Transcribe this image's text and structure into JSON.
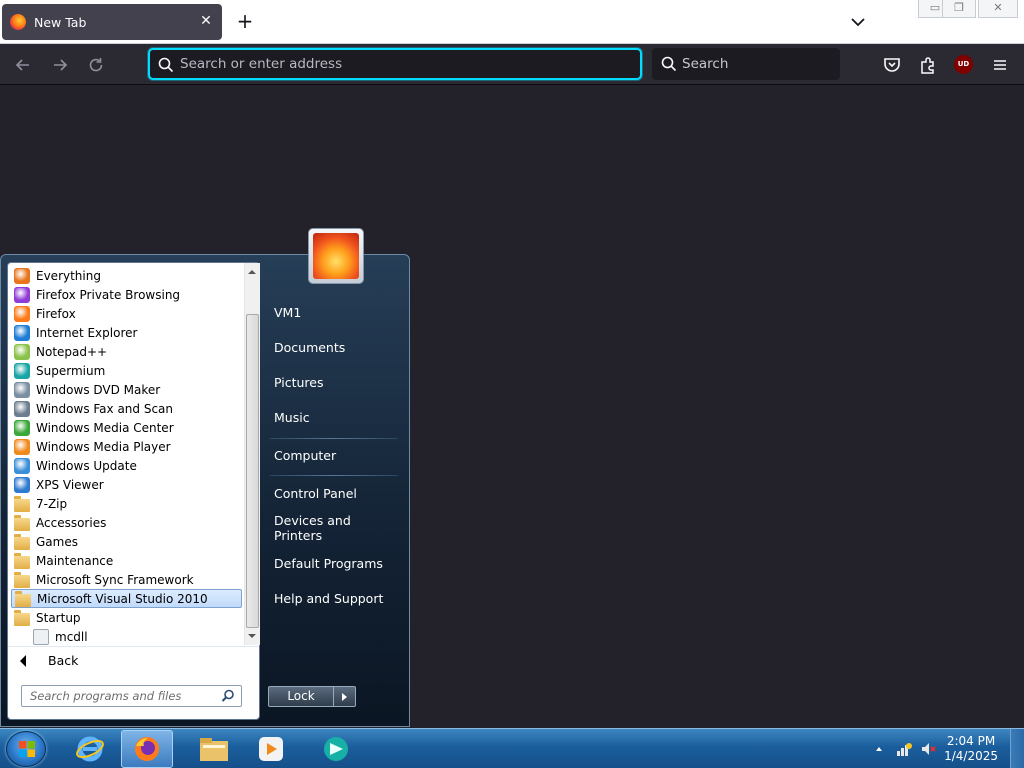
{
  "browser": {
    "tab_title": "New Tab",
    "address_placeholder": "Search or enter address",
    "search_placeholder": "Search",
    "ublock_badge": "UD"
  },
  "start_menu": {
    "programs": [
      {
        "label": "Everything",
        "icon": "everything-icon",
        "color": "#e8741b"
      },
      {
        "label": "Firefox Private Browsing",
        "icon": "firefox-private-icon",
        "color": "#8f3bd6"
      },
      {
        "label": "Firefox",
        "icon": "firefox-icon",
        "color": "#ff7a18"
      },
      {
        "label": "Internet Explorer",
        "icon": "internet-explorer-icon",
        "color": "#1e7dd4"
      },
      {
        "label": "Notepad++",
        "icon": "notepad-plus-plus-icon",
        "color": "#8bc34a"
      },
      {
        "label": "Supermium",
        "icon": "supermium-icon",
        "color": "#1aa6a6"
      },
      {
        "label": "Windows DVD Maker",
        "icon": "dvd-maker-icon",
        "color": "#7a8fa3"
      },
      {
        "label": "Windows Fax and Scan",
        "icon": "fax-scan-icon",
        "color": "#6b7d8f"
      },
      {
        "label": "Windows Media Center",
        "icon": "media-center-icon",
        "color": "#3aa83a"
      },
      {
        "label": "Windows Media Player",
        "icon": "media-player-icon",
        "color": "#f08a1c"
      },
      {
        "label": "Windows Update",
        "icon": "windows-update-icon",
        "color": "#3b8fd9"
      },
      {
        "label": "XPS Viewer",
        "icon": "xps-viewer-icon",
        "color": "#2f7ad1"
      },
      {
        "label": "7-Zip",
        "icon": "folder-icon",
        "color": "#e2ae45"
      },
      {
        "label": "Accessories",
        "icon": "folder-icon",
        "color": "#e2ae45"
      },
      {
        "label": "Games",
        "icon": "folder-icon",
        "color": "#e2ae45"
      },
      {
        "label": "Maintenance",
        "icon": "folder-icon",
        "color": "#e2ae45"
      },
      {
        "label": "Microsoft Sync Framework",
        "icon": "folder-icon",
        "color": "#e2ae45"
      },
      {
        "label": "Microsoft Visual Studio 2010",
        "icon": "folder-icon",
        "color": "#e2ae45",
        "selected": true
      },
      {
        "label": "Startup",
        "icon": "folder-icon",
        "color": "#e2ae45"
      },
      {
        "label": "mcdll",
        "icon": "shortcut-icon",
        "color": "#9aa6b2",
        "indent": true
      }
    ],
    "back_label": "Back",
    "search_placeholder": "Search programs and files",
    "right_links": [
      {
        "label": "VM1"
      },
      {
        "label": "Documents"
      },
      {
        "label": "Pictures"
      },
      {
        "label": "Music"
      },
      {
        "label": "Computer"
      },
      {
        "label": "Control Panel"
      },
      {
        "label": "Devices and Printers"
      },
      {
        "label": "Default Programs"
      },
      {
        "label": "Help and Support"
      }
    ],
    "lock_label": "Lock"
  },
  "taskbar": {
    "time": "2:04 PM",
    "date": "1/4/2025",
    "pinned": [
      "internet-explorer-icon",
      "firefox-icon",
      "file-explorer-icon",
      "media-player-icon",
      "supermium-icon"
    ]
  }
}
